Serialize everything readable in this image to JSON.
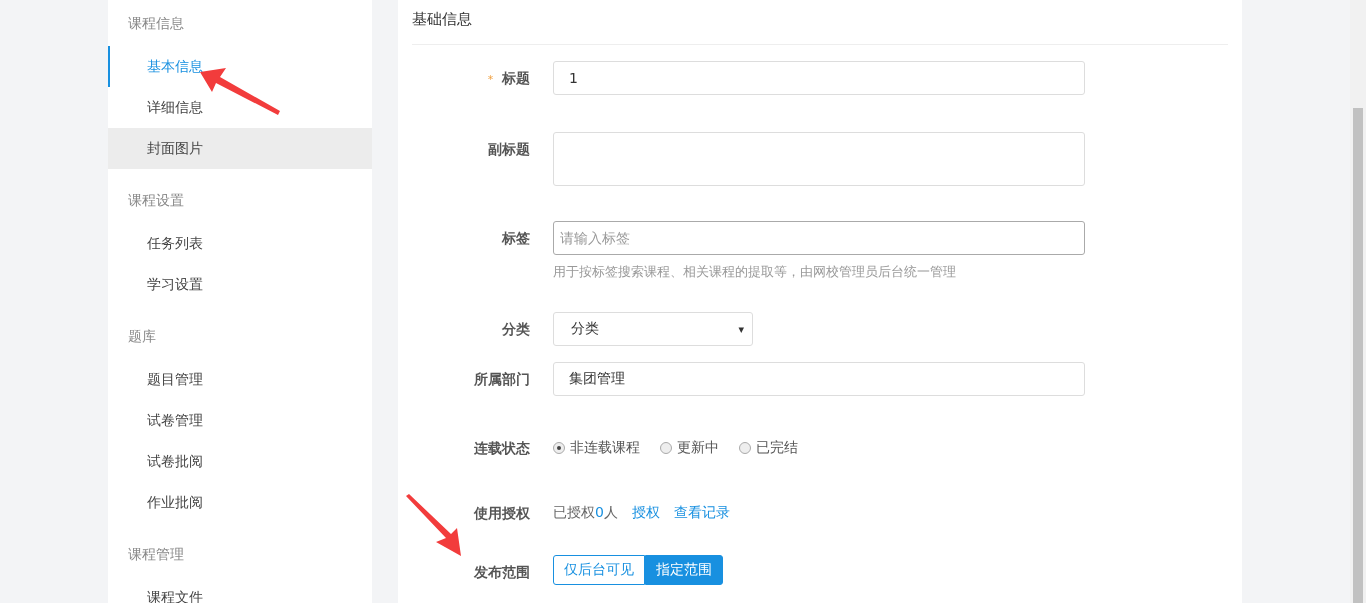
{
  "sidebar": {
    "groups": [
      {
        "title": "课程信息",
        "items": [
          {
            "label": "基本信息",
            "selected": true,
            "hovered": false
          },
          {
            "label": "详细信息",
            "selected": false,
            "hovered": false
          },
          {
            "label": "封面图片",
            "selected": false,
            "hovered": true
          }
        ]
      },
      {
        "title": "课程设置",
        "items": [
          {
            "label": "任务列表",
            "selected": false,
            "hovered": false
          },
          {
            "label": "学习设置",
            "selected": false,
            "hovered": false
          }
        ]
      },
      {
        "title": "题库",
        "items": [
          {
            "label": "题目管理",
            "selected": false,
            "hovered": false
          },
          {
            "label": "试卷管理",
            "selected": false,
            "hovered": false
          },
          {
            "label": "试卷批阅",
            "selected": false,
            "hovered": false
          },
          {
            "label": "作业批阅",
            "selected": false,
            "hovered": false
          }
        ]
      },
      {
        "title": "课程管理",
        "items": [
          {
            "label": "课程文件",
            "selected": false,
            "hovered": false
          }
        ]
      }
    ]
  },
  "form": {
    "heading": "基础信息",
    "required_mark": "*",
    "rows": [
      {
        "kind": "input",
        "label": "标题",
        "required": true,
        "value": "1"
      },
      {
        "kind": "textarea",
        "label": "副标题",
        "required": false
      },
      {
        "kind": "input",
        "label": "标签",
        "required": false,
        "placeholder": "请输入标签",
        "help": "用于按标签搜索课程、相关课程的提取等，由网校管理员后台统一管理"
      },
      {
        "kind": "select",
        "label": "分类",
        "required": false,
        "value": "分类",
        "caret": "▾"
      },
      {
        "kind": "input",
        "label": "所属部门",
        "required": false,
        "value": "集团管理"
      },
      {
        "kind": "radio",
        "label": "连载状态",
        "required": false,
        "options": [
          {
            "label": "非连载课程",
            "selected": true
          },
          {
            "label": "更新中",
            "selected": false
          },
          {
            "label": "已完结",
            "selected": false
          }
        ]
      },
      {
        "kind": "auth",
        "label": "使用授权",
        "required": false,
        "prefix": "已授权",
        "count": "0",
        "suffix": "人",
        "links": [
          "授权",
          "查看记录"
        ]
      },
      {
        "kind": "toggle",
        "label": "发布范围",
        "required": false,
        "options": [
          {
            "label": "仅后台可见",
            "selected": false
          },
          {
            "label": "指定范围",
            "selected": true
          }
        ]
      }
    ]
  }
}
